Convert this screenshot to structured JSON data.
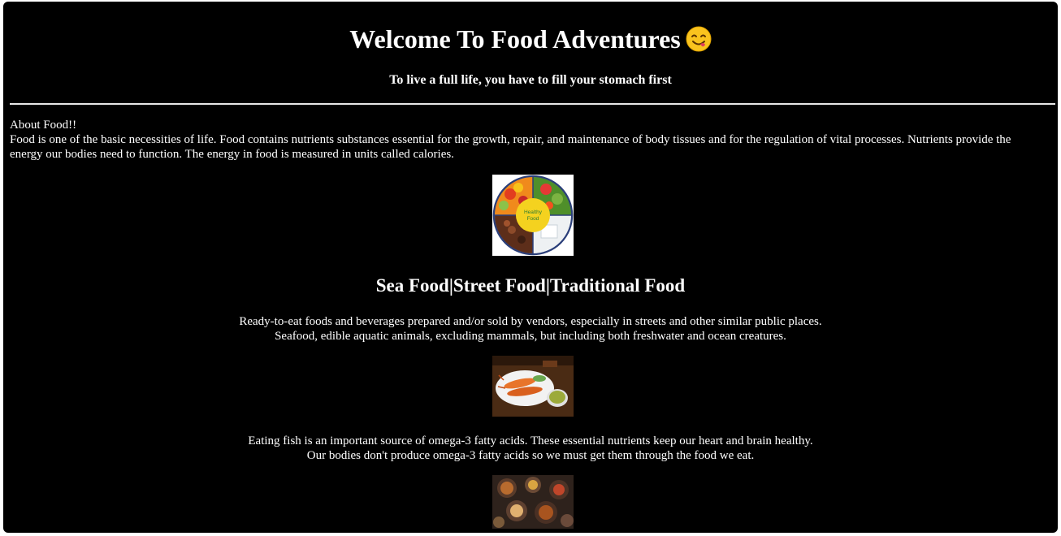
{
  "header": {
    "title": "Welcome To Food Adventures",
    "emoji": "savoring-food-face-icon",
    "tagline": "To live a full life, you have to fill your stomach first"
  },
  "about": {
    "heading": "About Food!!",
    "text": "Food is one of the basic necessities of life. Food contains nutrients substances essential for the growth, repair, and maintenance of body tissues and for the regulation of vital processes. Nutrients provide the energy our bodies need to function. The energy in food is measured in units called calories."
  },
  "images": {
    "healthy_plate_label_1": "Healthy",
    "healthy_plate_label_2": "Food"
  },
  "section": {
    "title": "Sea Food|Street Food|Traditional Food",
    "para1_line1": "Ready-to-eat foods and beverages prepared and/or sold by vendors, especially in streets and other similar public places.",
    "para1_line2": "Seafood, edible aquatic animals, excluding mammals, but including both freshwater and ocean creatures.",
    "para2_line1": "Eating fish is an important source of omega-3 fatty acids. These essential nutrients keep our heart and brain healthy.",
    "para2_line2": "Our bodies don't produce omega-3 fatty acids so we must get them through the food we eat."
  },
  "colors": {
    "page_background": "#000000",
    "text": "#ffffff",
    "divider": "#e8e8e8"
  }
}
